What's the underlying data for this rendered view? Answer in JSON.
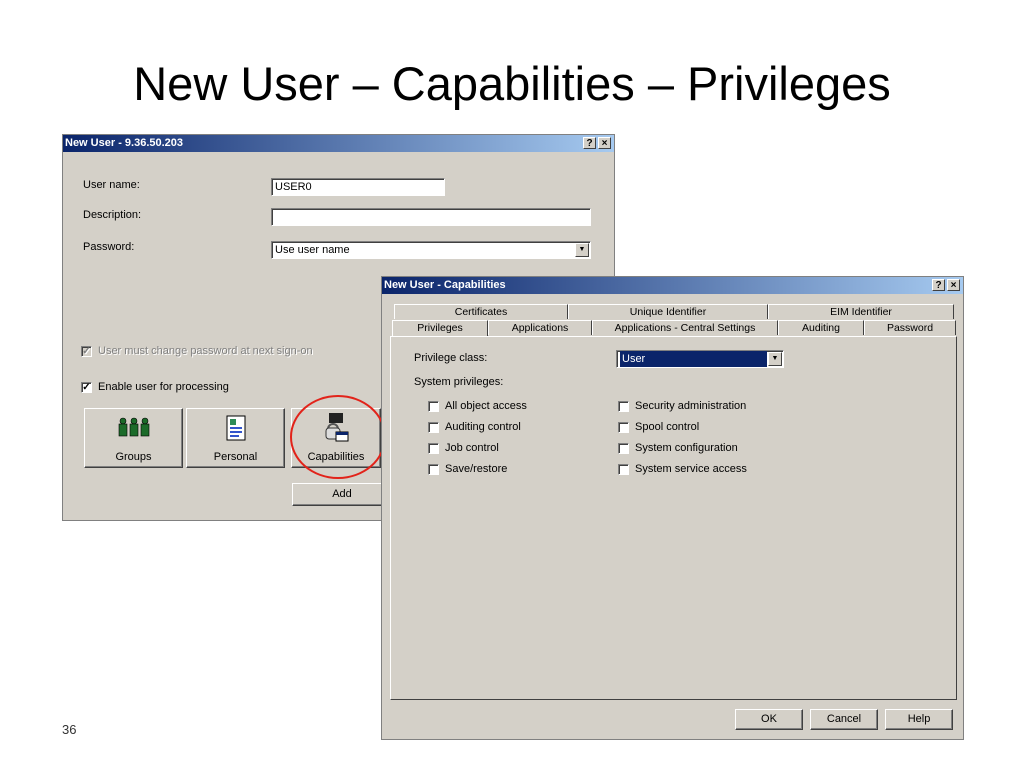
{
  "slide": {
    "title": "New User – Capabilities – Privileges",
    "number": "36"
  },
  "new_user_dialog": {
    "title": "New User - 9.36.50.203",
    "help_button": "?",
    "close_button": "×",
    "user_name_label": "User name:",
    "user_name_value": "USER0",
    "description_label": "Description:",
    "description_value": "",
    "password_label": "Password:",
    "password_value": "Use user name",
    "must_change_password": "User must change password at next sign-on",
    "must_change_checked": "✓",
    "enable_processing": "Enable user for processing",
    "enable_checked": "✓",
    "groups_button": "Groups",
    "personal_button": "Personal",
    "capabilities_button": "Capabilities",
    "add_button": "Add"
  },
  "capabilities_dialog": {
    "title": "New User - Capabilities",
    "help_button": "?",
    "close_button": "×",
    "tabs_back": [
      "Certificates",
      "Unique Identifier",
      "EIM Identifier"
    ],
    "tabs_front": [
      "Privileges",
      "Applications",
      "Applications - Central Settings",
      "Auditing",
      "Password"
    ],
    "privilege_class_label": "Privilege class:",
    "privilege_class_value": "User",
    "system_privileges_label": "System privileges:",
    "privileges_left": [
      "All object access",
      "Auditing control",
      "Job control",
      "Save/restore"
    ],
    "privileges_right": [
      "Security administration",
      "Spool control",
      "System configuration",
      "System service access"
    ],
    "ok_button": "OK",
    "cancel_button": "Cancel",
    "help_label": "Help"
  },
  "colors": {
    "titlebar_start": "#0a246a",
    "titlebar_end": "#a6caf0",
    "dialog_bg": "#d4d0c8",
    "highlight_circle": "#e2231a"
  }
}
